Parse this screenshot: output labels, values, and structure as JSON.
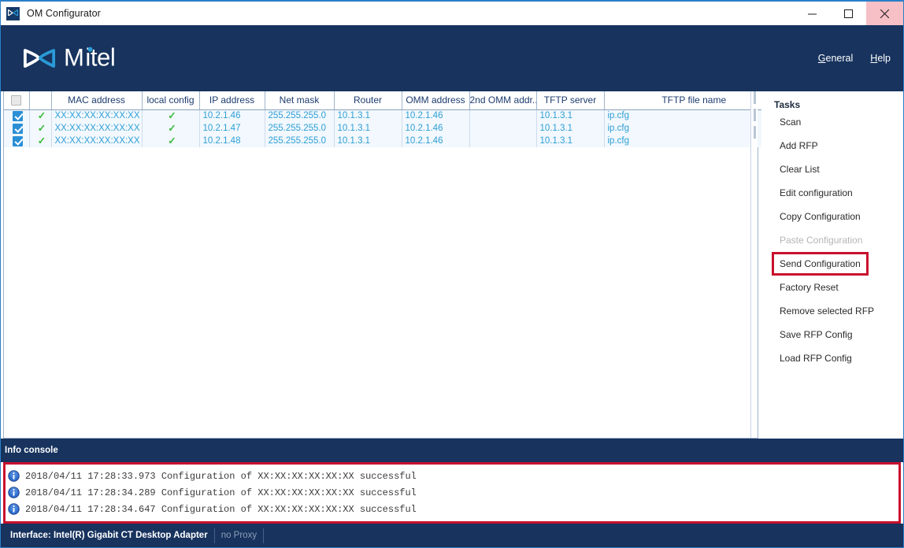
{
  "window": {
    "title": "OM Configurator",
    "icon": "mitel-bowtie-icon",
    "controls": {
      "minimize": "minimize-icon",
      "maximize": "maximize-icon",
      "close": "close-icon"
    }
  },
  "brand": {
    "logo_text": "Mitel",
    "logo_white": "#ffffff",
    "logo_accent": "#2a9ad6",
    "band_color": "#17335e",
    "nav": [
      {
        "accel": "G",
        "rest": "eneral"
      },
      {
        "accel": "H",
        "rest": "elp"
      }
    ]
  },
  "table": {
    "columns": [
      "",
      "",
      "MAC address",
      "local config",
      "IP address",
      "Net mask",
      "Router",
      "OMM address",
      "2nd OMM addr...",
      "TFTP server",
      "TFTP file name"
    ],
    "rows": [
      {
        "selected": true,
        "status": "ok",
        "mac": "XX:XX:XX:XX:XX:XX",
        "local_config": "ok",
        "ip": "10.2.1.46",
        "netmask": "255.255.255.0",
        "router": "10.1.3.1",
        "omm": "10.2.1.46",
        "omm2": "",
        "tftp_server": "10.1.3.1",
        "tftp_file": "ip.cfg"
      },
      {
        "selected": true,
        "status": "ok",
        "mac": "XX:XX:XX:XX:XX:XX",
        "local_config": "ok",
        "ip": "10.2.1.47",
        "netmask": "255.255.255.0",
        "router": "10.1.3.1",
        "omm": "10.2.1.46",
        "omm2": "",
        "tftp_server": "10.1.3.1",
        "tftp_file": "ip.cfg"
      },
      {
        "selected": true,
        "status": "ok",
        "mac": "XX:XX:XX:XX:XX:XX",
        "local_config": "ok",
        "ip": "10.2.1.48",
        "netmask": "255.255.255.0",
        "router": "10.1.3.1",
        "omm": "10.2.1.46",
        "omm2": "",
        "tftp_server": "10.1.3.1",
        "tftp_file": "ip.cfg"
      }
    ],
    "header_checkbox_checked": false,
    "row_text_color": "#2e9fd6",
    "tick_color": "#3cba3c"
  },
  "tasks": {
    "title": "Tasks",
    "items": [
      {
        "label": "Scan",
        "disabled": false,
        "highlighted": false
      },
      {
        "label": "Add RFP",
        "disabled": false,
        "highlighted": false
      },
      {
        "label": "Clear List",
        "disabled": false,
        "highlighted": false
      },
      {
        "label": "Edit configuration",
        "disabled": false,
        "highlighted": false
      },
      {
        "label": "Copy Configuration",
        "disabled": false,
        "highlighted": false
      },
      {
        "label": "Paste Configuration",
        "disabled": true,
        "highlighted": false
      },
      {
        "label": "Send Configuration",
        "disabled": false,
        "highlighted": true
      },
      {
        "label": "Factory Reset",
        "disabled": false,
        "highlighted": false
      },
      {
        "label": "Remove selected RFP",
        "disabled": false,
        "highlighted": false
      },
      {
        "label": "Save RFP Config",
        "disabled": false,
        "highlighted": false
      },
      {
        "label": "Load RFP Config",
        "disabled": false,
        "highlighted": false
      }
    ],
    "highlight_color": "#c8102e"
  },
  "console": {
    "title": "Info console",
    "border_color": "#c8102e",
    "lines": [
      {
        "icon": "info-icon",
        "text": "2018/04/11 17:28:33.973 Configuration of XX:XX:XX:XX:XX:XX successful"
      },
      {
        "icon": "info-icon",
        "text": "2018/04/11 17:28:34.289 Configuration of XX:XX:XX:XX:XX:XX successful"
      },
      {
        "icon": "info-icon",
        "text": "2018/04/11 17:28:34.647 Configuration of XX:XX:XX:XX:XX:XX successful"
      }
    ]
  },
  "statusbar": {
    "interface": "Interface: Intel(R) Gigabit CT Desktop Adapter",
    "proxy": "no Proxy"
  }
}
